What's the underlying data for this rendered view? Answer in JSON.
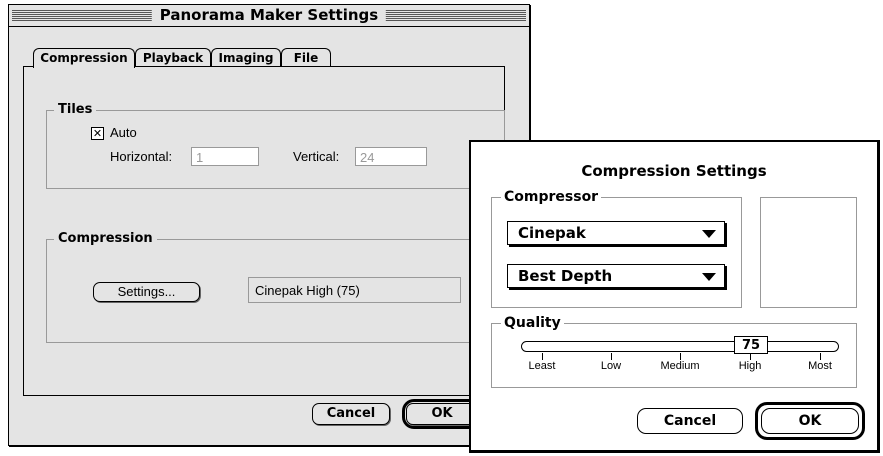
{
  "main_window": {
    "title": "Panorama Maker Settings",
    "tabs": [
      {
        "label": "Compression",
        "active": true
      },
      {
        "label": "Playback",
        "active": false
      },
      {
        "label": "Imaging",
        "active": false
      },
      {
        "label": "File",
        "active": false
      }
    ],
    "tiles": {
      "label": "Tiles",
      "auto_label": "Auto",
      "auto_checked": true,
      "auto_mark": "✕",
      "horizontal_label": "Horizontal:",
      "horizontal_value": "1",
      "vertical_label": "Vertical:",
      "vertical_value": "24"
    },
    "compression": {
      "label": "Compression",
      "settings_button": "Settings...",
      "current": "Cinepak High (75)"
    },
    "cancel_button": "Cancel",
    "ok_button": "OK"
  },
  "dialog": {
    "title": "Compression Settings",
    "compressor_label": "Compressor",
    "compressor_value": "Cinepak",
    "depth_value": "Best Depth",
    "quality_label": "Quality",
    "quality_value": "75",
    "quality_level": 0.75,
    "quality_ticks": [
      "Least",
      "Low",
      "Medium",
      "High",
      "Most"
    ],
    "cancel_button": "Cancel",
    "ok_button": "OK"
  }
}
